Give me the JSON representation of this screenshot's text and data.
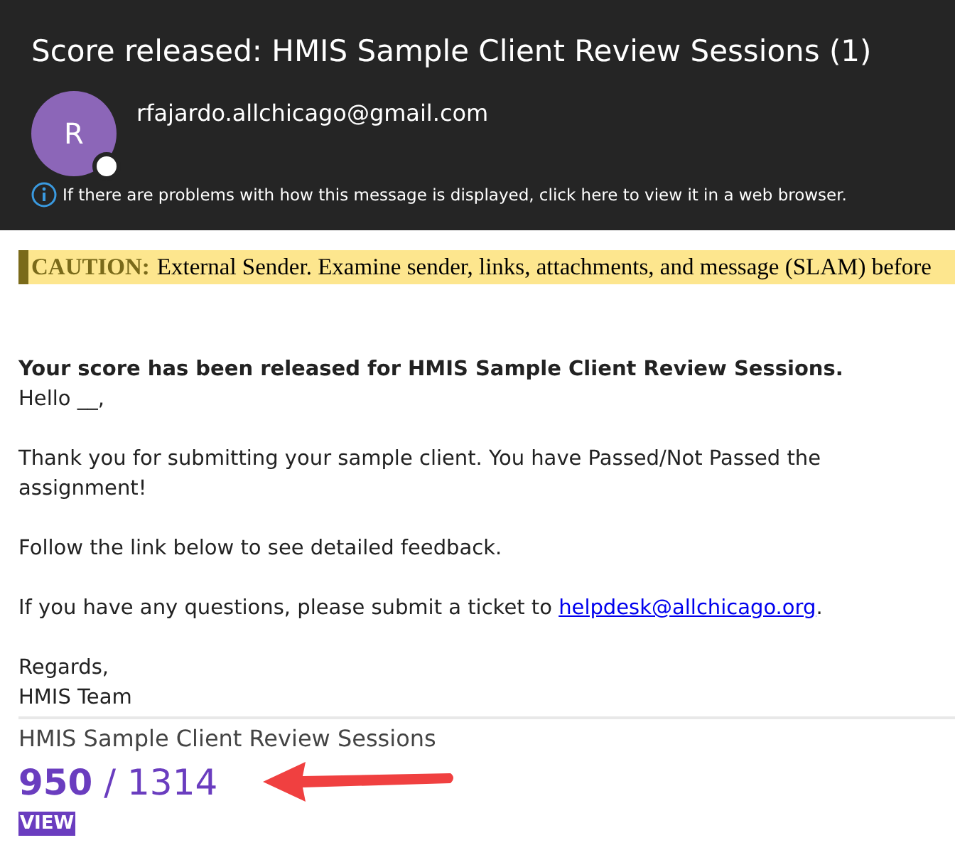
{
  "header": {
    "subject": "Score released: HMIS Sample Client Review Sessions (1)",
    "avatar_letter": "R",
    "sender": "rfajardo.allchicago@gmail.com",
    "info": "If there are problems with how this message is displayed, click here to view it in a web browser."
  },
  "caution": {
    "label": "CAUTION:",
    "text": "External Sender. Examine sender, links, attachments, and message (SLAM) before"
  },
  "body": {
    "heading": "Your score has been released for HMIS Sample Client Review Sessions.",
    "greeting": "Hello __,",
    "paragraphs": [
      {
        "text": "Thank you for submitting your sample client. You have Passed/Not Passed the assignment!"
      },
      {
        "text": "Follow the link below to see detailed feedback."
      },
      {
        "text": "If you have any questions, please submit a ticket to ",
        "link": "helpdesk@allchicago.org",
        "after": "."
      }
    ],
    "signoff": "Regards,",
    "team": "HMIS Team"
  },
  "score": {
    "title": "HMIS Sample Client Review Sessions",
    "score": "**950** / 1314",
    "button": "VIEW"
  }
}
